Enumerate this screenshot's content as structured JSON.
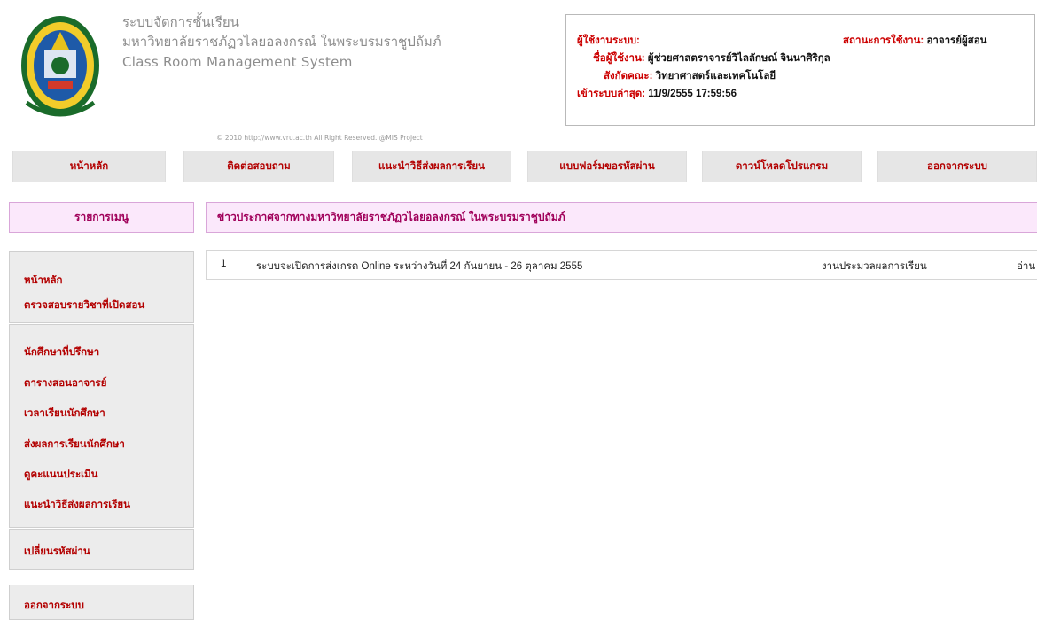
{
  "header": {
    "title_line1": "ระบบจัดการชั้นเรียน",
    "title_line2": "มหาวิทยาลัยราชภัฏวไลยอลงกรณ์ ในพระบรมราชูปถัมภ์",
    "title_line3": "Class Room Management System",
    "copyright": "© 2010 http://www.vru.ac.th All Right Reserved. @MIS Project"
  },
  "user_info": {
    "user_label": "ผู้ใช้งานระบบ:",
    "status_label": "สถานะการใช้งาน:",
    "status_value": "อาจารย์ผู้สอน",
    "name_label": "ชื่อผู้ใช้งาน:",
    "name_value": "ผู้ช่วยศาสตราจารย์วิไลลักษณ์ จินนาศิริกุล",
    "faculty_label": "สังกัดคณะ:",
    "faculty_value": "วิทยาศาสตร์และเทคโนโลยี",
    "last_login_label": "เข้าระบบล่าสุด:",
    "last_login_value": "11/9/2555 17:59:56"
  },
  "topnav": [
    {
      "label": "หน้าหลัก"
    },
    {
      "label": "ติดต่อสอบถาม"
    },
    {
      "label": "แนะนำวิธีส่งผลการเรียน"
    },
    {
      "label": "แบบฟอร์มขอรหัสผ่าน"
    },
    {
      "label": "ดาวน์โหลดโปรแกรม"
    },
    {
      "label": "ออกจากระบบ"
    }
  ],
  "sidebar": {
    "header": "รายการเมนู",
    "group1": [
      {
        "label": "หน้าหลัก"
      },
      {
        "label": "ตรวจสอบรายวิชาที่เปิดสอน"
      }
    ],
    "group2": [
      {
        "label": "นักศึกษาที่ปรึกษา"
      },
      {
        "label": "ตารางสอนอาจารย์"
      },
      {
        "label": "เวลาเรียนนักศึกษา"
      },
      {
        "label": "ส่งผลการเรียนนักศึกษา"
      },
      {
        "label": "ดูคะแนนประเมิน"
      },
      {
        "label": "แนะนำวิธีส่งผลการเรียน"
      }
    ],
    "group3": [
      {
        "label": "เปลี่ยนรหัสผ่าน"
      }
    ],
    "group4": [
      {
        "label": "ออกจากระบบ"
      }
    ]
  },
  "main": {
    "news_header": "ข่าวประกาศจากทางมหาวิทยาลัยราชภัฏวไลยอลงกรณ์ ในพระบรมราชูปถัมภ์",
    "news": [
      {
        "no": "1",
        "title": "ระบบจะเปิดการส่งเกรด Online ระหว่างวันที่ 24 กันยายน - 26 ตุลาคม 2555",
        "source": "งานประมวลผลการเรียน",
        "action": "อ่าน"
      }
    ]
  },
  "colors": {
    "nav_text": "#b30000",
    "header_bg": "#fbe8fb",
    "label_red": "#cc0000"
  }
}
